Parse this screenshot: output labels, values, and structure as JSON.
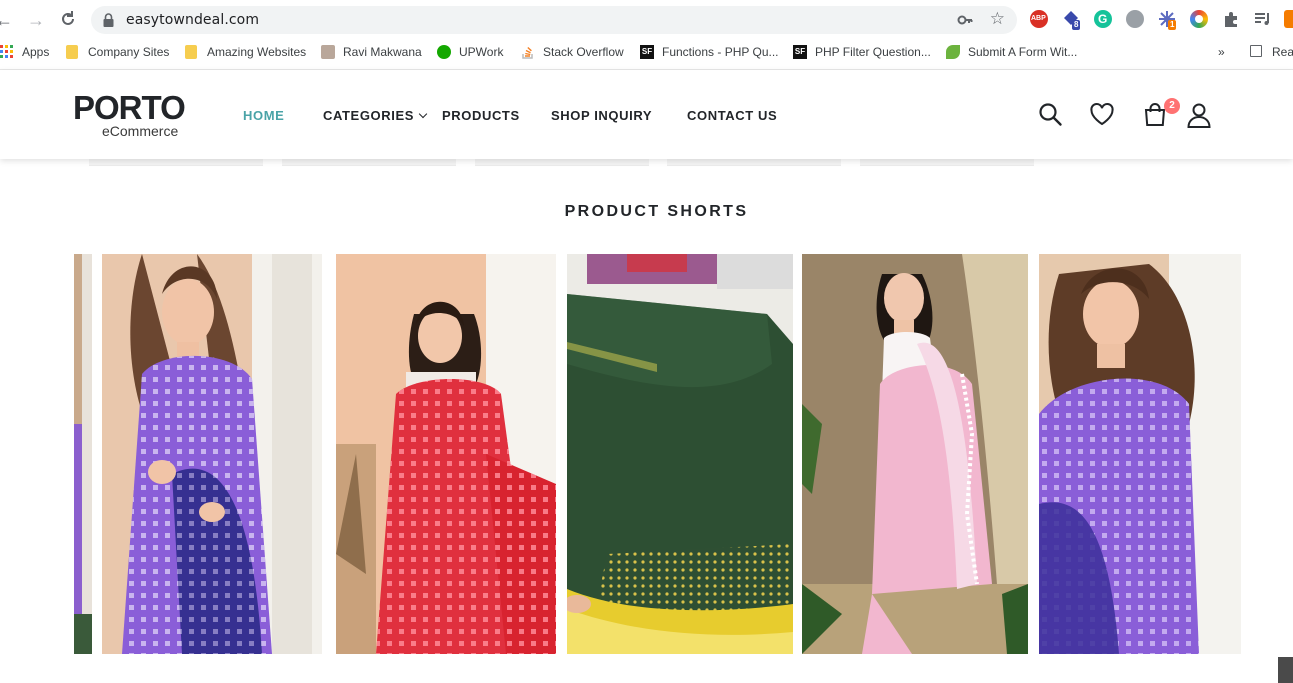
{
  "browser": {
    "url": "easytowndeal.com",
    "bookmarks": [
      {
        "label": "Apps",
        "icon": "apps-grid-icon"
      },
      {
        "label": "Company Sites",
        "icon": "folder-icon"
      },
      {
        "label": "Amazing Websites",
        "icon": "folder-icon"
      },
      {
        "label": "Ravi Makwana",
        "icon": "avatar-icon"
      },
      {
        "label": "UPWork",
        "icon": "upwork-icon"
      },
      {
        "label": "Stack Overflow",
        "icon": "stackoverflow-icon"
      },
      {
        "label": "Functions - PHP Qu...",
        "icon": "sf-icon"
      },
      {
        "label": "PHP Filter Question...",
        "icon": "sf-icon"
      },
      {
        "label": "Submit A Form Wit...",
        "icon": "leaf-icon"
      }
    ],
    "more_bookmarks": "»",
    "reading_list": "Rea",
    "extension_badges": {
      "ext2": "8",
      "ext5": "1"
    }
  },
  "header": {
    "logo_word": "PORTO",
    "logo_sub": "eCommerce",
    "nav": [
      {
        "label": "HOME",
        "active": true
      },
      {
        "label": "CATEGORIES",
        "has_dropdown": true
      },
      {
        "label": "PRODUCTS"
      },
      {
        "label": "SHOP INQUIRY"
      },
      {
        "label": "CONTACT US"
      }
    ],
    "cart_count": "2",
    "colors": {
      "accent": "#4aa3a7",
      "badge": "#ff7272",
      "text": "#222529"
    }
  },
  "section": {
    "title": "PRODUCT SHORTS",
    "shorts": [
      {
        "name": "short-partial-left",
        "main_color": "#8a5ed8"
      },
      {
        "name": "short-purple-saree",
        "main_color": "#8a5ed8"
      },
      {
        "name": "short-red-saree",
        "main_color": "#e83545"
      },
      {
        "name": "short-green-silk-fabric",
        "main_color": "#2d4f33"
      },
      {
        "name": "short-pink-saree",
        "main_color": "#f2b7cf"
      },
      {
        "name": "short-purple-saree-2",
        "main_color": "#8a5ed8"
      }
    ]
  }
}
